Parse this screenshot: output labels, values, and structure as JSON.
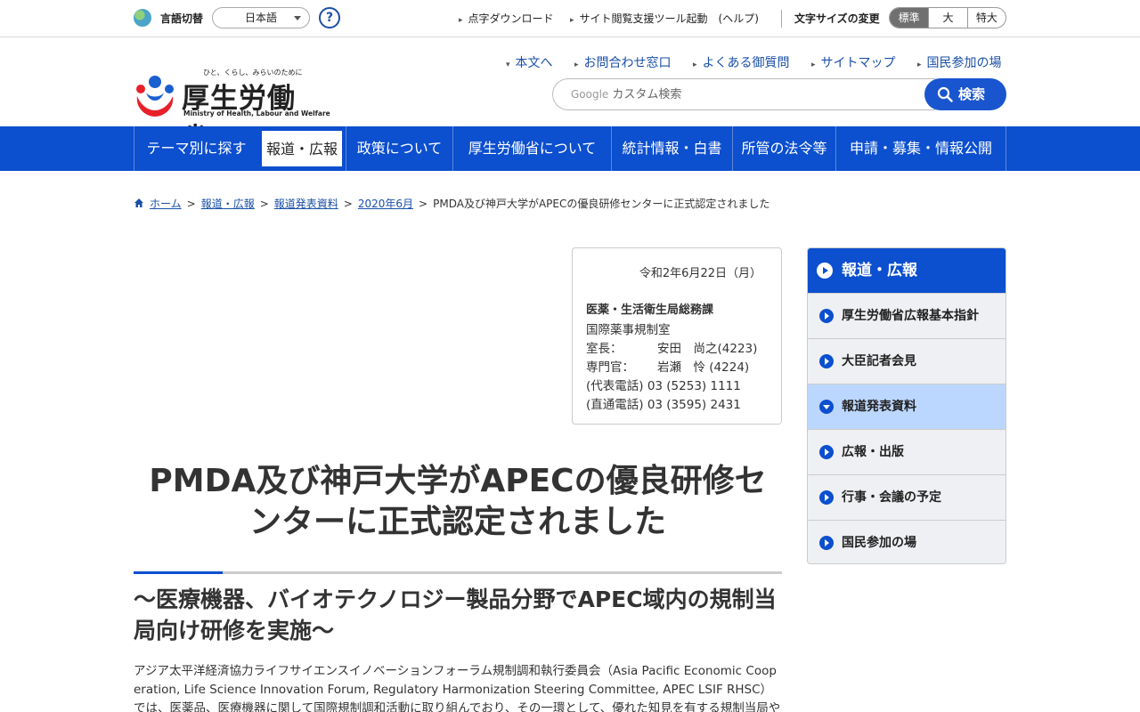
{
  "utility": {
    "lang_label": "言語切替",
    "lang_value": "日本語",
    "help": "?",
    "links": [
      "点字ダウンロード",
      "サイト閲覧支援ツール起動　(ヘルプ)"
    ],
    "font_size_label": "文字サイズの変更",
    "font_sizes": [
      "標準",
      "大",
      "特大"
    ]
  },
  "header": {
    "logo_tagline": "ひと、くらし、みらいのために",
    "logo_name": "厚生労働省",
    "logo_name_en": "Ministry of Health, Labour and Welfare",
    "links": [
      "本文へ",
      "お問合わせ窓口",
      "よくある御質問",
      "サイトマップ",
      "国民参加の場"
    ],
    "search_brand": "Google",
    "search_placeholder": "カスタム検索",
    "search_button": "検索"
  },
  "gnav": {
    "items": [
      "テーマ別に探す",
      "報道・広報",
      "政策について",
      "厚生労働省について",
      "統計情報・白書",
      "所管の法令等",
      "申請・募集・情報公開"
    ],
    "active_index": 1
  },
  "breadcrumb": {
    "items": [
      "ホーム",
      "報道・広報",
      "報道発表資料",
      "2020年6月"
    ],
    "current": "PMDA及び神戸大学がAPECの優良研修センターに正式認定されました"
  },
  "contact": {
    "date": "令和2年6月22日（月）",
    "dept": "医薬・生活衛生局総務課",
    "office": "国際薬事規制室",
    "chief_label": "室長：",
    "chief_name": "安田　尚之(4223)",
    "specialist_label": "専門官：",
    "specialist_name": "岩瀬　怜 (4224)",
    "tel_main": "(代表電話) 03 (5253) 1111",
    "tel_direct": "(直通電話) 03 (3595) 2431"
  },
  "article": {
    "title": "PMDA及び神戸大学がAPECの優良研修センターに正式認定されました",
    "subtitle": "～医療機器、バイオテクノロジー製品分野でAPEC域内の規制当局向け研修を実施～",
    "body": "アジア太平洋経済協力ライフサイエンスイノベーションフォーラム規制調和執行委員会（Asia Pacific Economic Cooperation, Life Science Innovation Forum, Regulatory Harmonization Steering Committee, APEC LSIF RHSC）では、医薬品、医療機器に関して国際規制調和活動に取り組んでおり、その一環として、優れた知見を有する規制当局やア"
  },
  "sidebar": {
    "heading": "報道・広報",
    "items": [
      "厚生労働省広報基本指針",
      "大臣記者会見",
      "報道発表資料",
      "広報・出版",
      "行事・会議の予定",
      "国民参加の場"
    ],
    "current_index": 2
  },
  "colors": {
    "brand_blue": "#0c4fcf",
    "current_item_bg": "#bcd7ff",
    "link": "#1a4fa8"
  }
}
